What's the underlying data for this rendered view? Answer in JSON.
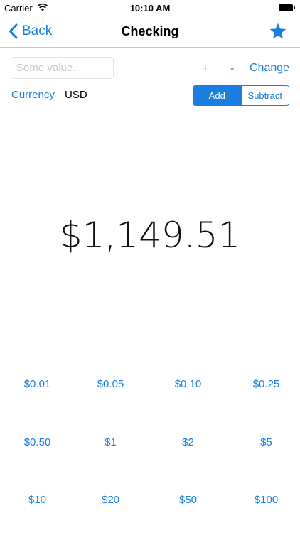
{
  "status_bar": {
    "carrier": "Carrier",
    "time": "10:10 AM"
  },
  "nav": {
    "back_label": "Back",
    "title": "Checking"
  },
  "entry": {
    "placeholder": "Some value...",
    "plus_label": "+",
    "minus_label": "-",
    "change_label": "Change"
  },
  "currency": {
    "label": "Currency",
    "code": "USD"
  },
  "mode": {
    "add_label": "Add",
    "subtract_label": "Subtract",
    "selected": "Add"
  },
  "balance": "$1,149.51",
  "denominations": [
    "$0.01",
    "$0.05",
    "$0.10",
    "$0.25",
    "$0.50",
    "$1",
    "$2",
    "$5",
    "$10",
    "$20",
    "$50",
    "$100"
  ],
  "colors": {
    "accent": "#1a7fe0"
  }
}
